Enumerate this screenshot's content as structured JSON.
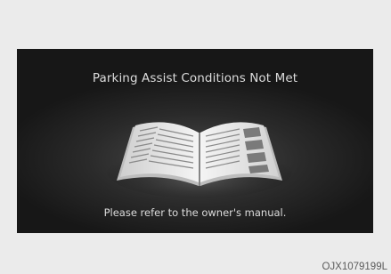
{
  "screen": {
    "title": "Parking Assist Conditions Not Met",
    "message": "Please refer to the owner's manual.",
    "illustration": "open-book-icon"
  },
  "figure_code": "OJX1079199L"
}
